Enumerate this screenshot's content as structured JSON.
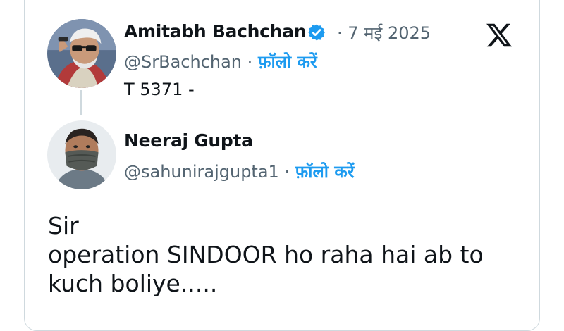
{
  "parent_tweet": {
    "author_name": "Amitabh Bachchan",
    "verified": true,
    "separator": "·",
    "date": "7 मई 2025",
    "handle": "@SrBachchan",
    "follow_label": "फ़ॉलो करें",
    "text": "T 5371 -"
  },
  "reply_tweet": {
    "author_name": "Neeraj Gupta",
    "separator": "·",
    "handle": "@sahunirajgupta1",
    "follow_label": "फ़ॉलो करें",
    "text_lines": [
      "Sir",
      "operation SINDOOR ho raha hai ab to",
      "kuch boliye....."
    ]
  },
  "colors": {
    "accent": "#1d9bf0",
    "text": "#0f1419",
    "secondary": "#536471",
    "border": "#cfd9de"
  },
  "icons": {
    "verified": "verified-badge-icon",
    "brand": "x-logo-icon"
  }
}
